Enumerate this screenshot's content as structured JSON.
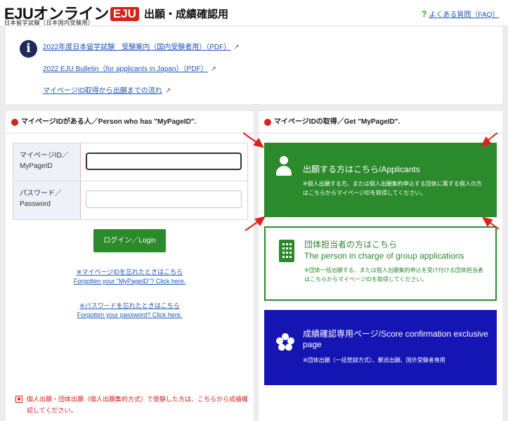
{
  "header": {
    "logo_text": "EJUオンライン",
    "logo_badge": "EJU",
    "logo_sub": "日本留学試験（日本国内受験用）",
    "title": "出願・成績確認用",
    "faq_label": "よくある質問（FAQ）"
  },
  "info": {
    "links": [
      "2022年度日本留学試験　受験案内（国内受験者用）（PDF）",
      "2022 EJU Bulletin（for applicants in Japan）（PDF）",
      "マイページID取得から出願までの流れ"
    ]
  },
  "left_panel": {
    "heading": "マイページIDがある人／Person who has \"MyPageID\".",
    "id_label_ja": "マイページID／",
    "id_label_en": "MyPageID",
    "id_value": "",
    "password_label_ja": "パスワード／",
    "password_label_en": "Password",
    "password_value": "",
    "login_button": "ログイン／Login",
    "forgot_id_ja": "※マイページIDを忘れたときはこちら",
    "forgot_id_en": "Forgotten your \"MyPageID\"? Click here.",
    "forgot_pw_ja": "※パスワードを忘れたときはこちら",
    "forgot_pw_en": "Forgotten your password? Click here.",
    "notice": "個人出願・団体出願（個人出願集約方式）で受験した方は、こちらから成績確認してください。"
  },
  "right_panel": {
    "heading": "マイページIDの取得／Get \"MyPageID\".",
    "cards": [
      {
        "title": "出願する方はこちら/Applicants",
        "note": "※個人出願する方、または個人出願集約申込する団体に属する個人の方はこちらからマイページIDを取得してください。",
        "icon": "person-icon"
      },
      {
        "title_ja": "団体担当者の方はこちら",
        "title_en": "The person in charge of group applications",
        "note": "※団体一括出願する、または個人出願集約申込を受け付ける団体担当者はこちらからマイページIDを取得してください。",
        "icon": "building-icon"
      },
      {
        "title": "成績確認専用ページ/Score confirmation exclusive page",
        "note": "※団体出願（一括登録方式）、郵送出願、国外受験者専用",
        "icon": "flower-icon"
      }
    ]
  },
  "colors": {
    "green": "#2b8a2b",
    "blue": "#1515b4",
    "red": "#d7211b",
    "link": "#1e56b8"
  }
}
